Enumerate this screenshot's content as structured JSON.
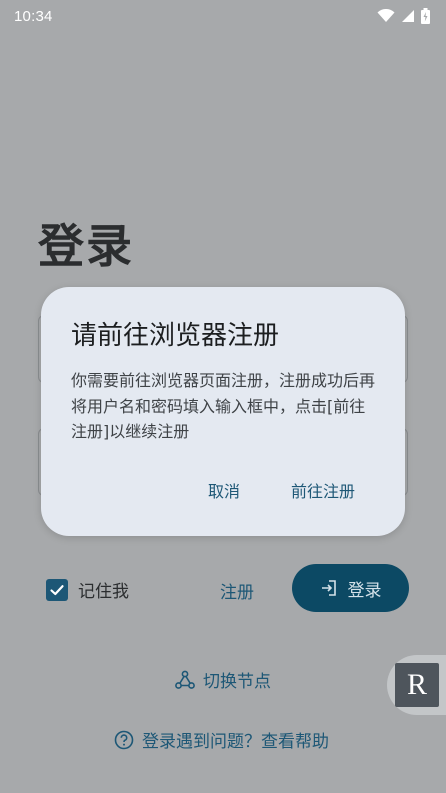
{
  "status_bar": {
    "time": "10:34",
    "icons": [
      "wifi-icon",
      "signal-icon",
      "battery-icon"
    ]
  },
  "login": {
    "title": "登录",
    "remember_me_label": "记住我",
    "remember_me_checked": true,
    "register_label": "注册",
    "login_button_label": "登录",
    "switch_node_label": "切换节点",
    "help_label": "登录遇到问题？查看帮助"
  },
  "floating_widget": {
    "letter": "R"
  },
  "dialog": {
    "title": "请前往浏览器注册",
    "message": "你需要前往浏览器页面注册，注册成功后再将用户名和密码填入输入框中，点击[前往注册]以继续注册",
    "cancel_label": "取消",
    "confirm_label": "前往注册"
  },
  "colors": {
    "accent": "#0c4964",
    "link": "#1d5776",
    "dialog_bg": "#e4e9f1",
    "scrim_bg": "#a7a9ab"
  }
}
